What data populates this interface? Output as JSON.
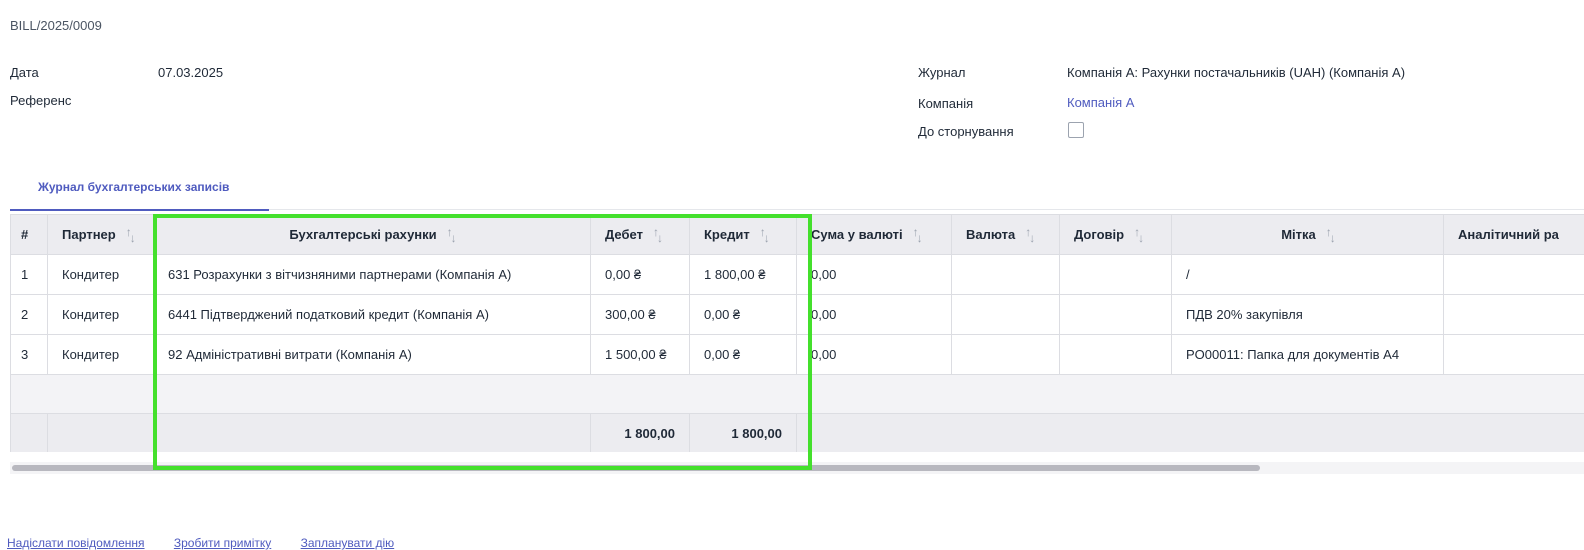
{
  "document": {
    "name": "BILL/2025/0009"
  },
  "left_fields": {
    "date_label": "Дата",
    "date_value": "07.03.2025",
    "reference_label": "Референс"
  },
  "right_fields": {
    "journal_label": "Журнал",
    "journal_value": "Компанія А: Рахунки постачальників (UAH) (Компанія А)",
    "company_label": "Компанія",
    "company_value": "Компанія А",
    "reversal_label": "До сторнування",
    "reversal_checked": false
  },
  "tabs": [
    {
      "label": "Журнал бухгалтерських записів",
      "active": true
    }
  ],
  "table": {
    "headers": {
      "num": "#",
      "partner": "Партнер",
      "account": "Бухгалтерські рахунки",
      "debit": "Дебет",
      "credit": "Кредит",
      "amount_currency": "Сума у валюті",
      "currency": "Валюта",
      "contract": "Договір",
      "label": "Мітка",
      "analytic": "Аналітичний ра"
    },
    "rows": [
      {
        "num": "1",
        "partner": "Кондитер",
        "account": "631 Розрахунки з вітчизняними партнерами (Компанія А)",
        "debit": "0,00 ₴",
        "credit": "1 800,00 ₴",
        "amount_currency": "0,00",
        "currency": "",
        "contract": "",
        "label": "/",
        "analytic": ""
      },
      {
        "num": "2",
        "partner": "Кондитер",
        "account": "6441 Підтверджений податковий кредит (Компанія А)",
        "debit": "300,00 ₴",
        "credit": "0,00 ₴",
        "amount_currency": "0,00",
        "currency": "",
        "contract": "",
        "label": "ПДВ 20% закупівля",
        "analytic": ""
      },
      {
        "num": "3",
        "partner": "Кондитер",
        "account": "92 Адміністративні витрати (Компанія А)",
        "debit": "1 500,00 ₴",
        "credit": "0,00 ₴",
        "amount_currency": "0,00",
        "currency": "",
        "contract": "",
        "label": "PO00011: Папка для документів А4",
        "analytic": ""
      }
    ],
    "totals": {
      "debit": "1 800,00",
      "credit": "1 800,00"
    }
  },
  "highlight_color": "#44e02c",
  "accent_color": "#4f5bbf",
  "footer_links": [
    "Надіслати повідомлення",
    "Зробити примітку",
    "Запланувати дію"
  ]
}
